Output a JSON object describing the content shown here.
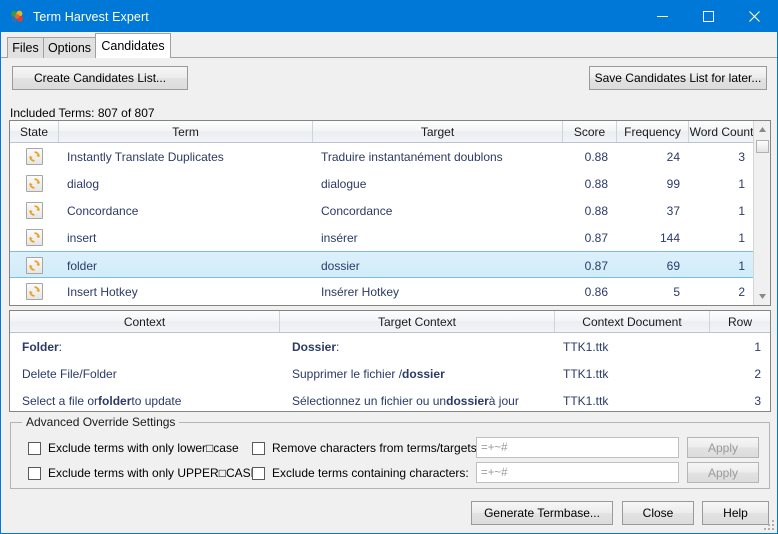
{
  "window": {
    "title": "Term Harvest Expert",
    "app_icon": "pinwheel-icon",
    "minimize_label": "–",
    "maximize_label": "□",
    "close_label": "✕",
    "accent_color": "#0078d7"
  },
  "tabs": [
    {
      "label": "Files",
      "active": false
    },
    {
      "label": "Options",
      "active": false
    },
    {
      "label": "Candidates",
      "active": true
    }
  ],
  "toolbar": {
    "create_list_label": "Create Candidates List...",
    "save_list_label": "Save Candidates List for later..."
  },
  "status": {
    "included_terms": "Included Terms: 807 of 807"
  },
  "candidates_grid": {
    "columns": [
      "State",
      "Term",
      "Target",
      "Score",
      "Frequency",
      "Word Count"
    ],
    "rows": [
      {
        "state_icon": "refresh-icon",
        "term": "Instantly Translate Duplicates",
        "target": "Traduire instantanément doublons",
        "score": "0.88",
        "frequency": "24",
        "word_count": "3",
        "selected": false
      },
      {
        "state_icon": "refresh-icon",
        "term": "dialog",
        "target": "dialogue",
        "score": "0.88",
        "frequency": "99",
        "word_count": "1",
        "selected": false
      },
      {
        "state_icon": "refresh-icon",
        "term": "Concordance",
        "target": "Concordance",
        "score": "0.88",
        "frequency": "37",
        "word_count": "1",
        "selected": false
      },
      {
        "state_icon": "refresh-icon",
        "term": "insert",
        "target": "insérer",
        "score": "0.87",
        "frequency": "144",
        "word_count": "1",
        "selected": false
      },
      {
        "state_icon": "refresh-icon",
        "term": "folder",
        "target": "dossier",
        "score": "0.87",
        "frequency": "69",
        "word_count": "1",
        "selected": true
      },
      {
        "state_icon": "refresh-icon",
        "term": "Insert Hotkey",
        "target": "Insérer Hotkey",
        "score": "0.86",
        "frequency": "5",
        "word_count": "2",
        "selected": false
      }
    ]
  },
  "context_grid": {
    "columns": [
      "Context",
      "Target Context",
      "Context Document",
      "Row"
    ],
    "rows": [
      {
        "context_parts": [
          {
            "t": "Folder",
            "b": true
          },
          {
            "t": ":",
            "b": false
          }
        ],
        "target_parts": [
          {
            "t": "Dossier",
            "b": true
          },
          {
            "t": ":",
            "b": false
          }
        ],
        "document": "TTK1.ttk",
        "row": "1"
      },
      {
        "context_parts": [
          {
            "t": "Delete File/Folder",
            "b": false
          }
        ],
        "target_parts": [
          {
            "t": "Supprimer le fichier / ",
            "b": false
          },
          {
            "t": "dossier",
            "b": true
          }
        ],
        "document": "TTK1.ttk",
        "row": "2"
      },
      {
        "context_parts": [
          {
            "t": "Select a file or ",
            "b": false
          },
          {
            "t": "folder",
            "b": true
          },
          {
            "t": " to update",
            "b": false
          }
        ],
        "target_parts": [
          {
            "t": "Sélectionnez un fichier ou un ",
            "b": false
          },
          {
            "t": "dossier",
            "b": true
          },
          {
            "t": " à jour",
            "b": false
          }
        ],
        "document": "TTK1.ttk",
        "row": "3"
      }
    ]
  },
  "advanced": {
    "group_title": "Advanced Override Settings",
    "checkbox_lowercase": "Exclude terms with only lower□case",
    "checkbox_uppercase": "Exclude terms with only UPPER□CASE",
    "checkbox_remove_chars": "Remove characters from terms/targets:",
    "checkbox_exclude_chars": "Exclude terms containing characters:",
    "remove_chars_value": "=+~#",
    "exclude_chars_value": "=+~#",
    "apply_label_1": "Apply",
    "apply_label_2": "Apply"
  },
  "footer": {
    "generate_label": "Generate Termbase...",
    "close_label": "Close",
    "help_label": "Help"
  }
}
